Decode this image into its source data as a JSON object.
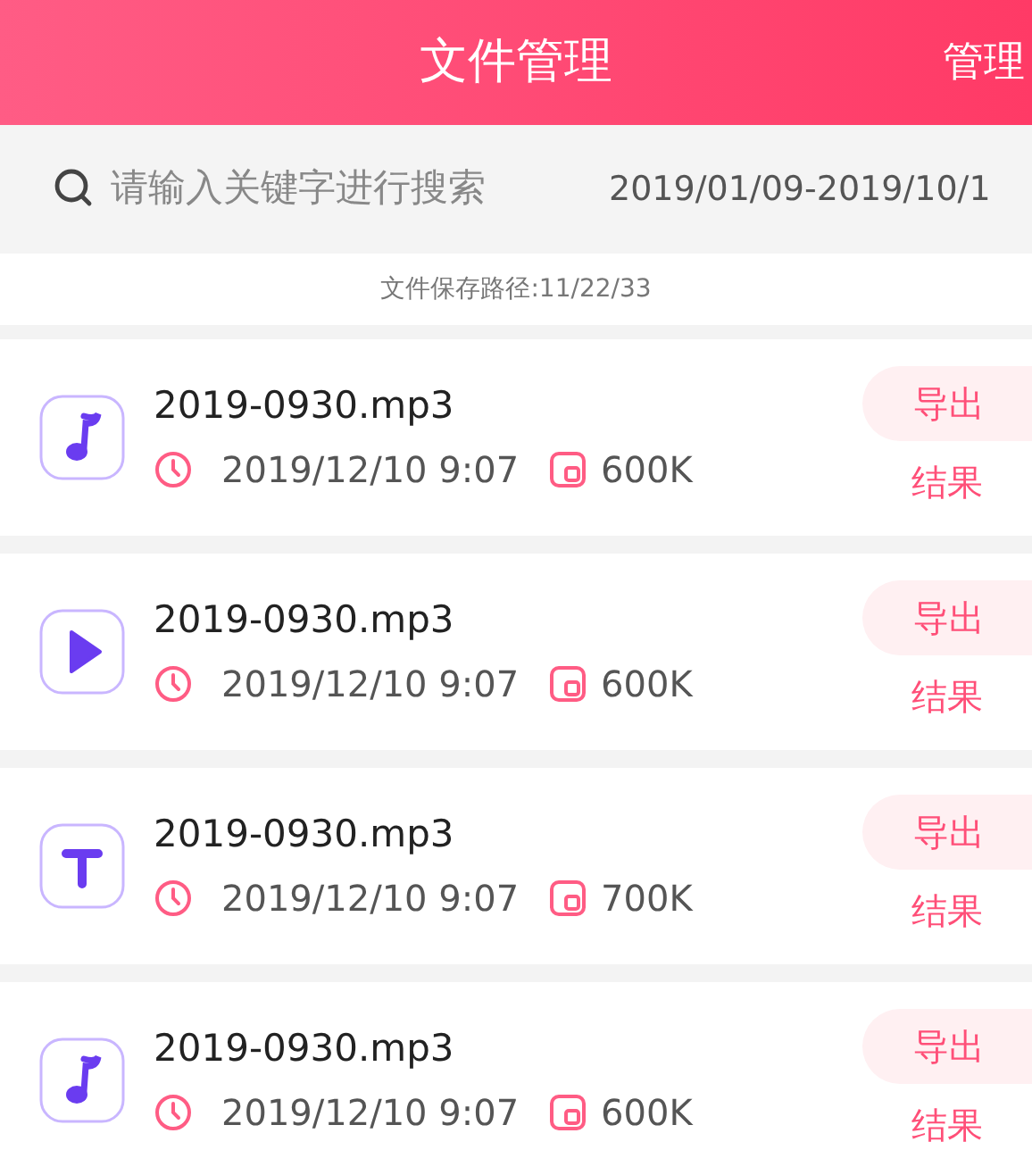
{
  "header": {
    "title": "文件管理",
    "action": "管理"
  },
  "search": {
    "placeholder": "请输入关键字进行搜索",
    "date_range": "2019/01/09-2019/10/1"
  },
  "save_path": "文件保存路径:11/22/33",
  "files": [
    {
      "kind": "music",
      "name": "2019-0930.mp3",
      "time": "2019/12/10 9:07",
      "size": "600K",
      "export_label": "导出",
      "result_label": "结果"
    },
    {
      "kind": "video",
      "name": "2019-0930.mp3",
      "time": "2019/12/10 9:07",
      "size": "600K",
      "export_label": "导出",
      "result_label": "结果"
    },
    {
      "kind": "text",
      "name": "2019-0930.mp3",
      "time": "2019/12/10 9:07",
      "size": "700K",
      "export_label": "导出",
      "result_label": "结果"
    },
    {
      "kind": "music",
      "name": "2019-0930.mp3",
      "time": "2019/12/10 9:07",
      "size": "600K",
      "export_label": "导出",
      "result_label": "结果"
    }
  ]
}
